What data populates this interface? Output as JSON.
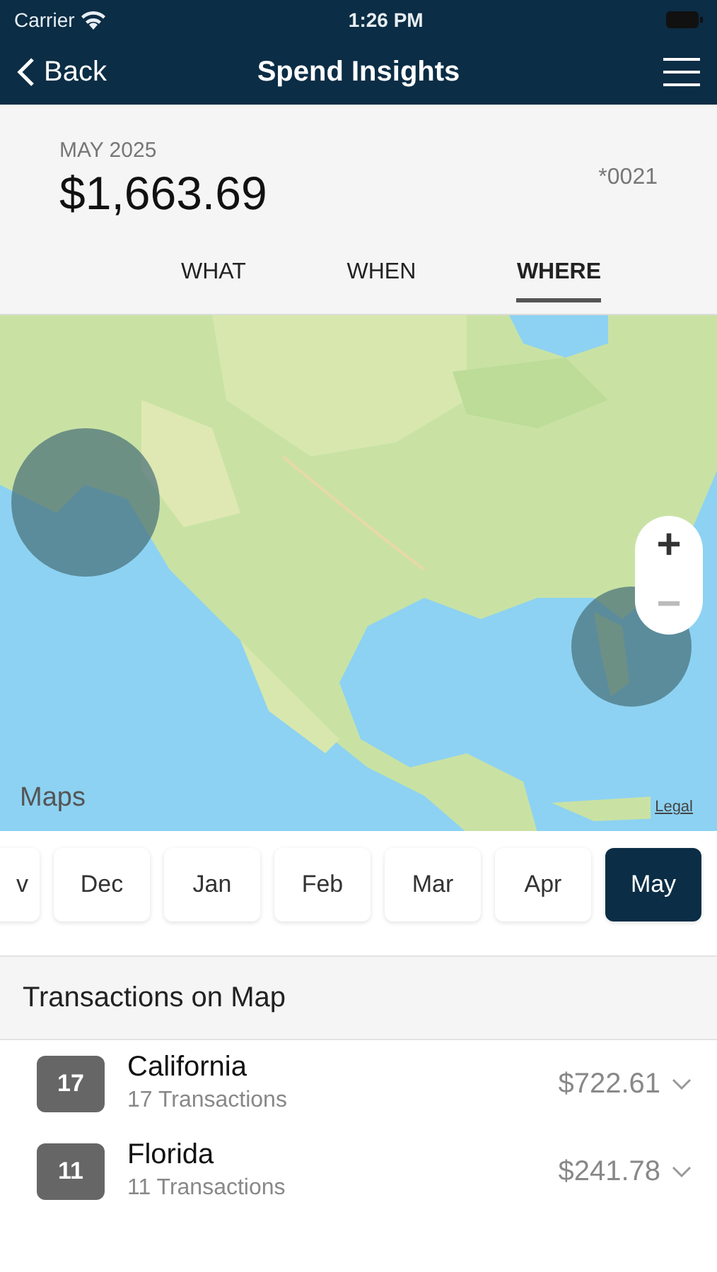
{
  "status_bar": {
    "carrier": "Carrier",
    "time": "1:26 PM"
  },
  "nav": {
    "back": "Back",
    "title": "Spend Insights"
  },
  "summary": {
    "period": "MAY 2025",
    "amount": "$1,663.69",
    "account": "*0021"
  },
  "tabs": [
    {
      "label": "WHAT",
      "selected": false
    },
    {
      "label": "WHEN",
      "selected": false
    },
    {
      "label": "WHERE",
      "selected": true
    }
  ],
  "map": {
    "kind": "picture",
    "attribution": "Maps",
    "legal": "Legal",
    "markers": [
      {
        "kind": "circle"
      },
      {
        "kind": "circle"
      }
    ],
    "zoom_in": {
      "label": "+",
      "disabled": false
    },
    "zoom_out": {
      "label": "−",
      "disabled": true
    }
  },
  "months": [
    {
      "label": "v",
      "selected": false
    },
    {
      "label": "Dec",
      "selected": false
    },
    {
      "label": "Jan",
      "selected": false
    },
    {
      "label": "Feb",
      "selected": false
    },
    {
      "label": "Mar",
      "selected": false
    },
    {
      "label": "Apr",
      "selected": false
    },
    {
      "label": "May",
      "selected": true
    }
  ],
  "section_title": "Transactions on Map",
  "locations": [
    {
      "count": "17",
      "name": "California",
      "transactions": "17 Transactions",
      "amount": "$722.61",
      "expanded": false
    },
    {
      "count": "11",
      "name": "Florida",
      "transactions": "11 Transactions",
      "amount": "$241.78",
      "expanded": false
    }
  ]
}
